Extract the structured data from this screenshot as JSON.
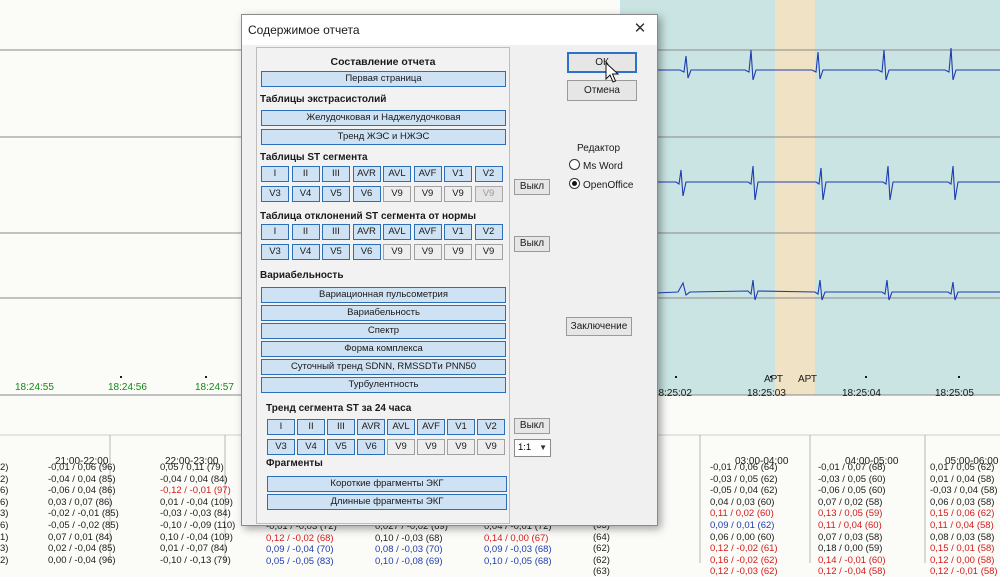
{
  "dialog": {
    "title": "Содержимое отчета",
    "close": "✕",
    "header": "Составление отчета",
    "first_page": "Первая страница",
    "sections": {
      "extrasystoles": "Таблицы экстрасистолий",
      "st_tables": "Таблицы ST сегмента",
      "st_deviation": "Таблица отклонений ST сегмента от нормы",
      "variability": "Вариабельность",
      "st_trend": "Тренд сегмента ST за 24 часа",
      "fragments": "Фрагменты"
    },
    "extrasystole_items": [
      "Желудочковая и Наджелудочковая",
      "Тренд ЖЭС и НЖЭС"
    ],
    "lead_row1": [
      "I",
      "II",
      "III",
      "AVR",
      "AVL",
      "AVF",
      "V1",
      "V2"
    ],
    "lead_row2": [
      "V3",
      "V4",
      "V5",
      "V6",
      "V9",
      "V9",
      "V9",
      "V9"
    ],
    "variability_items": [
      "Вариационная пульсометрия",
      "Вариабельность",
      "Спектр",
      "Форма комплекса",
      "Суточный тренд SDNN, RMSSDTи PNN50",
      "Турбулентность"
    ],
    "fragment_items": [
      "Короткие фрагменты ЭКГ",
      "Длинные фрагменты ЭКГ"
    ],
    "off_label": "Выкл",
    "scale_value": "1:1",
    "ok": "ОК",
    "cancel": "Отмена",
    "editor_label": "Редактор",
    "editor_options": [
      "Ms Word",
      "OpenOffice"
    ],
    "editor_selected": "OpenOffice",
    "conclusion": "Заключение"
  },
  "background": {
    "time_left": [
      "18:24:55",
      "18:24:56",
      "18:24:57"
    ],
    "time_right": [
      "18:25:02",
      "18:25:03",
      "18:25:04",
      "18:25:05"
    ],
    "art_labels": [
      "АРТ",
      "АРТ"
    ],
    "hour_headers": [
      "21:00-22:00",
      "22:00-23:00",
      "03:00-04:00",
      "04:00-05:00",
      "05:00-06:00"
    ],
    "columns": [
      {
        "rows": [
          "2)",
          "2)",
          "6)",
          "6)",
          "3)",
          "6)",
          "1)",
          "3)",
          "2)"
        ]
      },
      {
        "rows": [
          "-0,01 / 0,06 (96)",
          "-0,04 / 0,04 (85)",
          "-0,06 / 0,04 (86)",
          "0,03 / 0,07 (86)",
          "-0,02 / -0,01 (85)",
          "-0,05 / -0,02 (85)",
          "0,07 / 0,01 (84)",
          "0,02 / -0,04 (85)",
          "0,00 / -0,04 (96)"
        ]
      },
      {
        "rows": [
          "0,05 / 0,11 (79)",
          "-0,04 / 0,04 (84)",
          "-0,12 / -0,01 (97)",
          "0,01 / -0,04 (109)",
          "-0,03 / -0,03 (84)",
          "-0,10 / -0,09 (110)",
          "0,10 / -0,04 (109)",
          "0,01 / -0,07 (84)",
          "-0,10 / -0,13 (79)"
        ]
      },
      {
        "rows": [
          "-0,01 / -0,03 (72)",
          "0,12 / -0,02 (68)",
          "0,09 / -0,04 (70)",
          "0,05 / -0,05 (83)"
        ]
      },
      {
        "rows": [
          "0,027 / -0,02 (69)",
          "0,10 / -0,03 (68)",
          "0,08 / -0,03 (70)",
          "0,10 / -0,08 (69)"
        ]
      },
      {
        "rows": [
          "0,04 / -0,01 (72)",
          "0,14 / 0,00 (67)",
          "0,09 / -0,03 (68)",
          "0,10 / -0,05 (68)"
        ]
      },
      {
        "rows": [
          "(68)",
          "(63)",
          "(62)",
          "(65)",
          "(63)",
          "(63)",
          "(64)",
          "(62)",
          "(62)",
          "(63)"
        ]
      },
      {
        "rows": [
          "-0,01 / 0,06 (64)",
          "-0,03 / 0,05 (62)",
          "-0,05 / 0,04 (62)",
          "0,04 / 0,03 (60)",
          "0,11 / 0,02 (60)",
          "0,09 / 0,01 (62)",
          "0,06 / 0,00 (60)",
          "0,12 / -0,02 (61)",
          "0,16 / -0,02 (62)",
          "0,12 / -0,03 (62)"
        ]
      },
      {
        "rows": [
          "-0,01 / 0,07 (68)",
          "-0,03 / 0,05 (60)",
          "-0,06 / 0,05 (60)",
          "0,07 / 0,02 (58)",
          "0,13 / 0,05 (59)",
          "0,11 / 0,04 (60)",
          "0,07 / 0,03 (58)",
          "0,18 / 0,00 (59)",
          "0,14 / -0,01 (60)",
          "0,12 / -0,04 (58)"
        ]
      },
      {
        "rows": [
          "0,01 / 0,05 (62)",
          "0,01 / 0,04 (58)",
          "-0,03 / 0,04 (58)",
          "0,06 / 0,03 (58)",
          "0,15 / 0,06 (62)",
          "0,11 / 0,04 (58)",
          "0,08 / 0,03 (58)",
          "0,15 / 0,01 (58)",
          "0,12 / 0,00 (58)",
          "0,12 / -0,01 (58)"
        ]
      }
    ]
  },
  "colors": {
    "button_fill": "#cfe2f3",
    "button_border": "#2a6fb8",
    "ecg_trace": "#1f3cb0",
    "teal_band": "#c9e4e2",
    "sand_band": "#f0e2c4",
    "time_green": "#118a11",
    "value_red": "#d41a1a"
  }
}
